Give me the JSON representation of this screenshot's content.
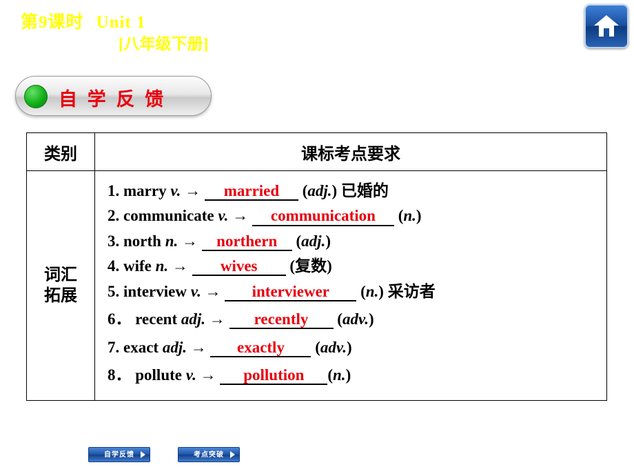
{
  "header": {
    "lesson": "第9课时",
    "unit": "Unit 1",
    "grade": "[八年级下册]",
    "home_icon": "home-icon"
  },
  "banner": {
    "label": "自 学 反 馈"
  },
  "table": {
    "headers": [
      "类别",
      "课标考点要求"
    ],
    "category": "词汇\n拓展",
    "rows": [
      {
        "num": "1.",
        "word": "marry",
        "pos": "v.",
        "arrow": "→",
        "answer": "married",
        "tail_pos": "adj.",
        "tail": "已婚的"
      },
      {
        "num": "2.",
        "word": "communicate",
        "pos": "v.",
        "arrow": "→",
        "answer": "communication",
        "tail_pos": "n.",
        "tail": ""
      },
      {
        "num": "3.",
        "word": "north",
        "pos": "n.",
        "arrow": "→",
        "answer": "northern",
        "tail_pos": "adj.",
        "tail": ""
      },
      {
        "num": "4.",
        "word": "wife",
        "pos": "n.",
        "arrow": "→",
        "answer": "wives",
        "tail_pos": "",
        "tail": "(复数)"
      },
      {
        "num": "5.",
        "word": "interview",
        "pos": "v.",
        "arrow": "→",
        "answer": "interviewer",
        "tail_pos": "n.",
        "tail": "采访者"
      },
      {
        "num": "6．",
        "word": "recent",
        "pos": "adj.",
        "arrow": "→",
        "answer": "recently",
        "tail_pos": "adv.",
        "tail": ""
      },
      {
        "num": "7.",
        "word": "exact",
        "pos": "adj.",
        "arrow": "→",
        "answer": "exactly",
        "tail_pos": "adv.",
        "tail": ""
      },
      {
        "num": "8．",
        "word": "pollute",
        "pos": "v.",
        "arrow": "→",
        "answer": "pollution",
        "tail_pos": "n.",
        "tail": ""
      }
    ]
  },
  "footer": {
    "buttons": [
      {
        "label": "自学反馈"
      },
      {
        "label": "考点突破"
      }
    ]
  },
  "colors": {
    "title": "#ffff00",
    "accent_red": "#e8000d",
    "button_blue": "#1d53a6"
  }
}
